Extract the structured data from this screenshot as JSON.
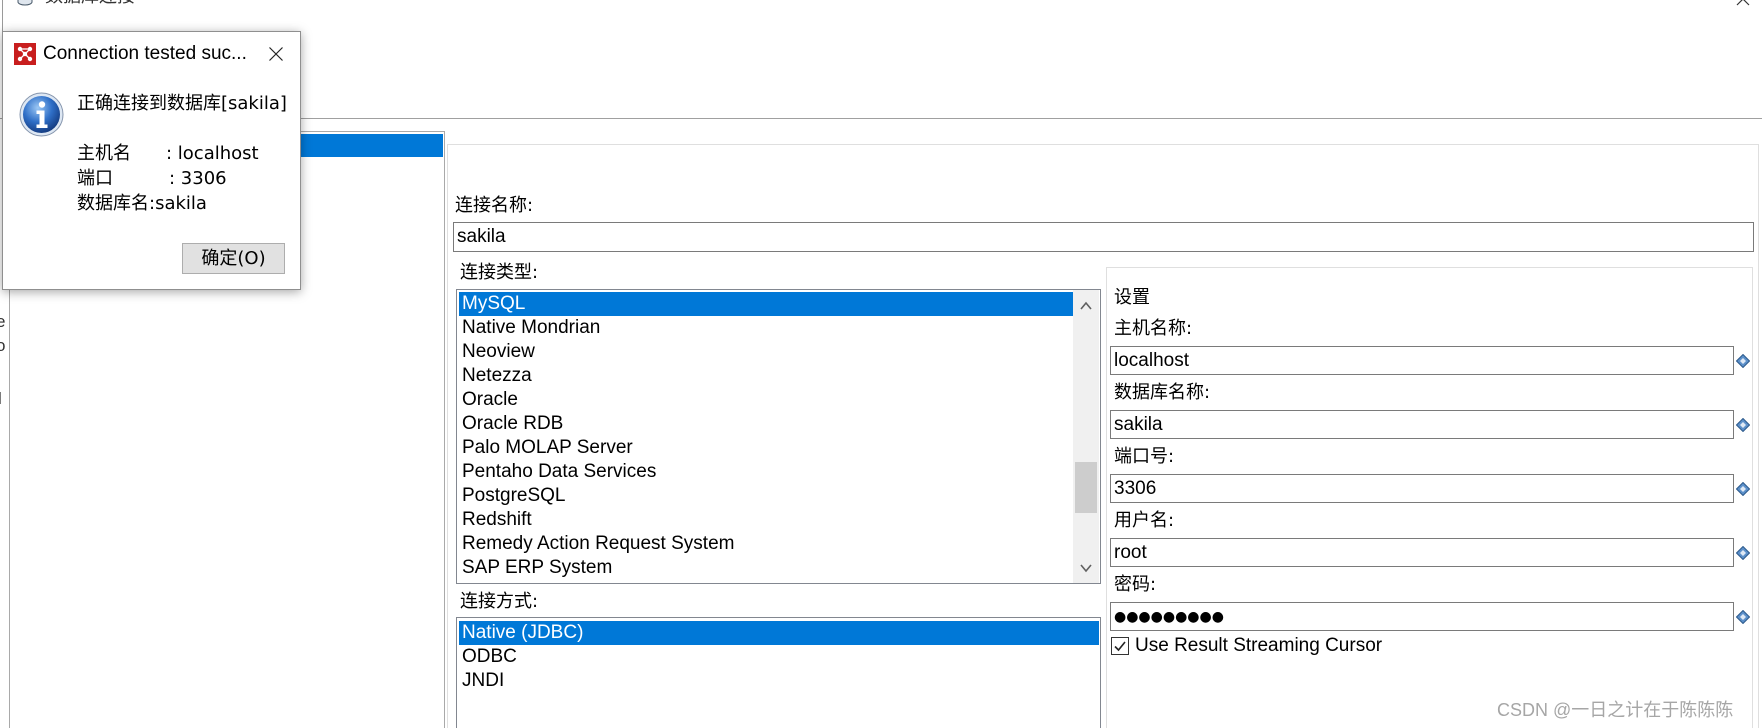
{
  "window": {
    "title": "数据库连接"
  },
  "background_fragments": [
    "e",
    "o",
    "l"
  ],
  "general": {
    "connection_name_label": "连接名称:",
    "connection_name_value": "sakila",
    "connection_type_label": "连接类型:",
    "connection_types": [
      "MySQL",
      "Native Mondrian",
      "Neoview",
      "Netezza",
      "Oracle",
      "Oracle RDB",
      "Palo MOLAP Server",
      "Pentaho Data Services",
      "PostgreSQL",
      "Redshift",
      "Remedy Action Request System",
      "SAP ERP System"
    ],
    "connection_type_selected": "MySQL",
    "connection_types_scroll_fraction": 0.78,
    "access_label": "连接方式:",
    "access_types": [
      "Native (JDBC)",
      "ODBC",
      "JNDI"
    ],
    "access_selected": "Native (JDBC)"
  },
  "settings": {
    "title": "设置",
    "host_label": "主机名称:",
    "host_value": "localhost",
    "database_label": "数据库名称:",
    "database_value": "sakila",
    "port_label": "端口号:",
    "port_value": "3306",
    "user_label": "用户名:",
    "user_value": "root",
    "password_label": "密码:",
    "password_value": "●●●●●●●●●",
    "streaming_cursor_label": "Use Result Streaming Cursor",
    "streaming_cursor_checked": true,
    "field_icon": "variable-diamond-icon"
  },
  "dialog": {
    "title": "Connection tested suc...",
    "app_icon": "app-logo-icon",
    "icon": "info-icon",
    "message": "正确连接到数据库[sakila]",
    "host_label": "主机名",
    "host_value": ": localhost",
    "port_label": "端口",
    "port_value": ": 3306",
    "database_line": "数据库名:sakila",
    "ok_button": "确定(O)"
  },
  "watermark": "CSDN @一日之计在于陈陈陈",
  "colors": {
    "selection": "#0078d7",
    "selection_text": "#ffffff",
    "text": "#000000",
    "watermark": "#a6a6a6",
    "app_icon": "#c81e1e",
    "info_icon": "#2f6fc7"
  }
}
